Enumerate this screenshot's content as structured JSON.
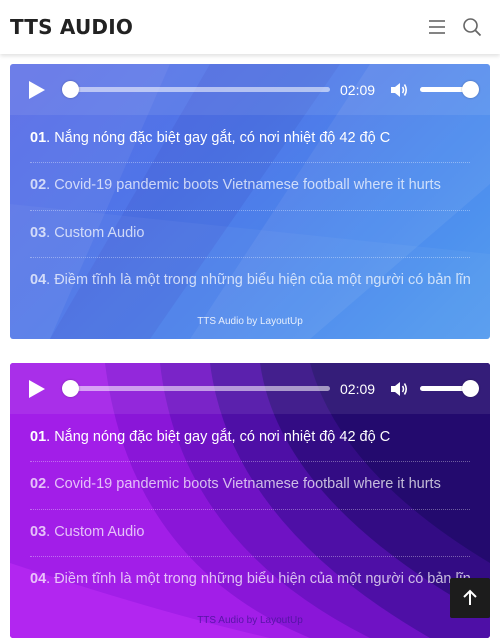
{
  "header": {
    "title": "TTS AUDIO",
    "menu_icon": "hamburger-menu-icon",
    "search_icon": "search-icon"
  },
  "players": [
    {
      "theme": "blue",
      "accent": "#4f7bea",
      "time": "02:09",
      "progress": 0,
      "volume": 1,
      "tracks": [
        {
          "num": "01",
          "title": ". Nắng nóng đặc biệt gay gắt, có nơi nhiệt độ 42 độ C"
        },
        {
          "num": "02",
          "title": ". Covid-19 pandemic boots Vietnamese football where it hurts"
        },
        {
          "num": "03",
          "title": ". Custom Audio"
        },
        {
          "num": "04",
          "title": ". Điềm tĩnh là một trong những biểu hiện của một người có bản lĩnh"
        }
      ],
      "active_track": 0,
      "credit": "TTS Audio by LayoutUp"
    },
    {
      "theme": "purple",
      "accent": "#9c1be8",
      "time": "02:09",
      "progress": 0,
      "volume": 1,
      "tracks": [
        {
          "num": "01",
          "title": ". Nắng nóng đặc biệt gay gắt, có nơi nhiệt độ 42 độ C"
        },
        {
          "num": "02",
          "title": ". Covid-19 pandemic boots Vietnamese football where it hurts"
        },
        {
          "num": "03",
          "title": ". Custom Audio"
        },
        {
          "num": "04",
          "title": ". Điềm tĩnh là một trong những biểu hiện của một người có bản lĩnh"
        }
      ],
      "active_track": 0,
      "credit": "TTS Audio by LayoutUp"
    }
  ],
  "back_to_top_icon": "arrow-up-icon"
}
